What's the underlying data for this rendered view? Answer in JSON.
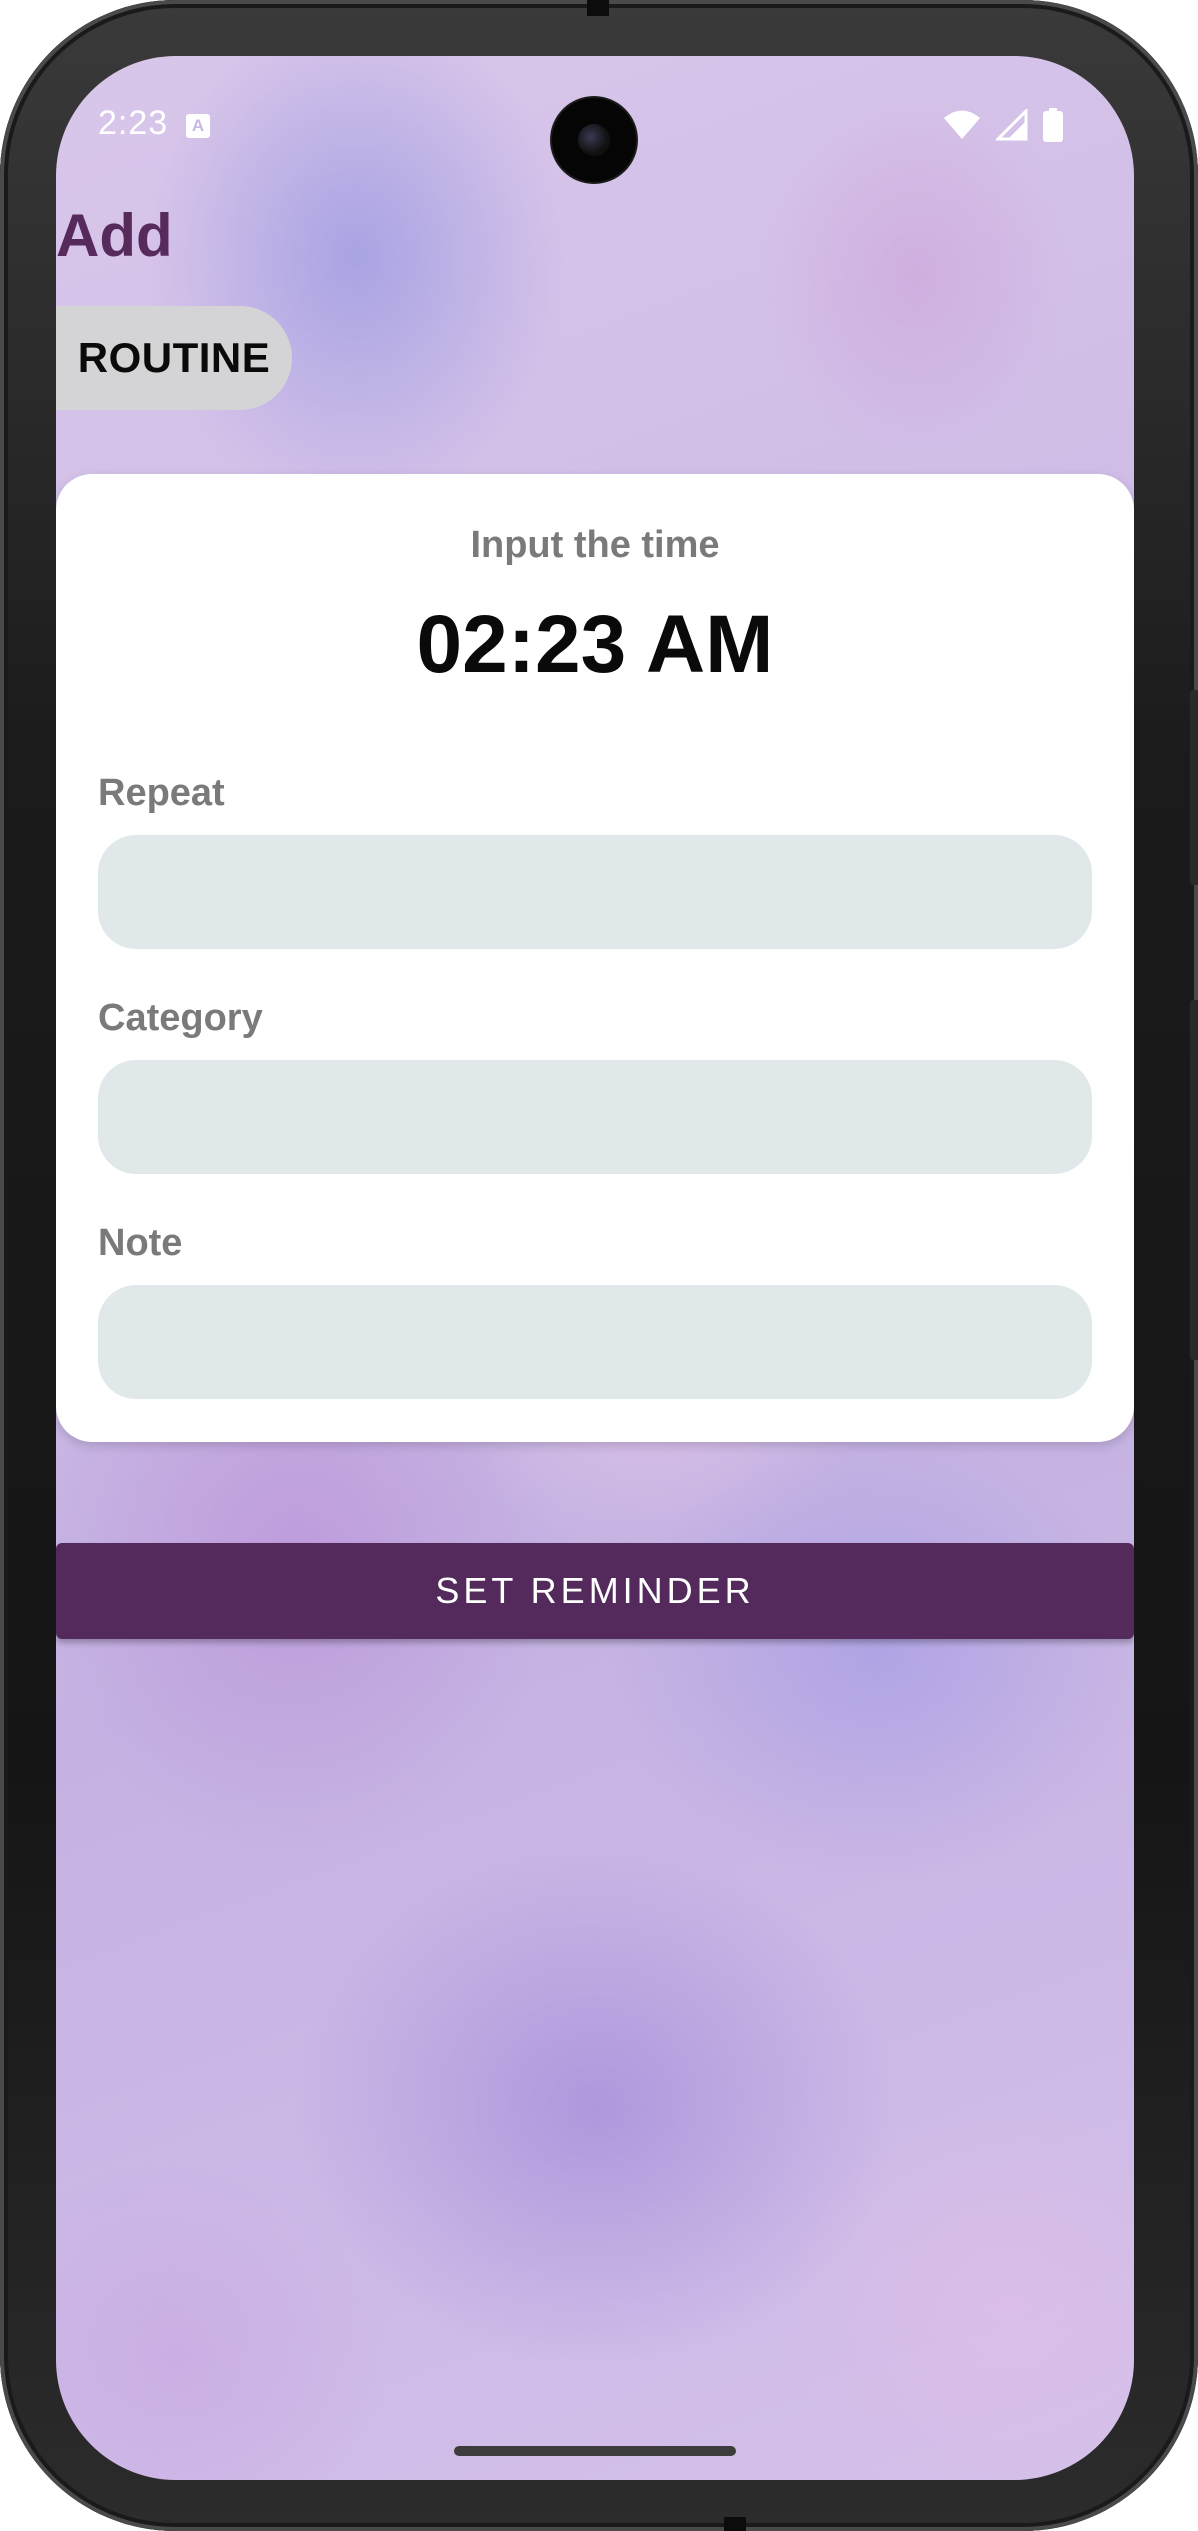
{
  "status_bar": {
    "time": "2:23",
    "notification_icon_letter": "A",
    "icons": [
      "wifi-icon",
      "cellular-signal-icon",
      "battery-icon"
    ]
  },
  "header": {
    "title": "Add"
  },
  "chip": {
    "label": "ROUTINE"
  },
  "card": {
    "subtitle": "Input the time",
    "time_value": "02:23 AM",
    "fields": [
      {
        "label": "Repeat",
        "value": "",
        "placeholder": ""
      },
      {
        "label": "Category",
        "value": "",
        "placeholder": ""
      },
      {
        "label": "Note",
        "value": "",
        "placeholder": ""
      }
    ]
  },
  "actions": {
    "set_reminder_label": "SET REMINDER"
  },
  "colors": {
    "accent": "#532a5b",
    "title": "#562a5b",
    "field_background": "#e0e8e9",
    "chip_background": "#d4d4d6"
  }
}
